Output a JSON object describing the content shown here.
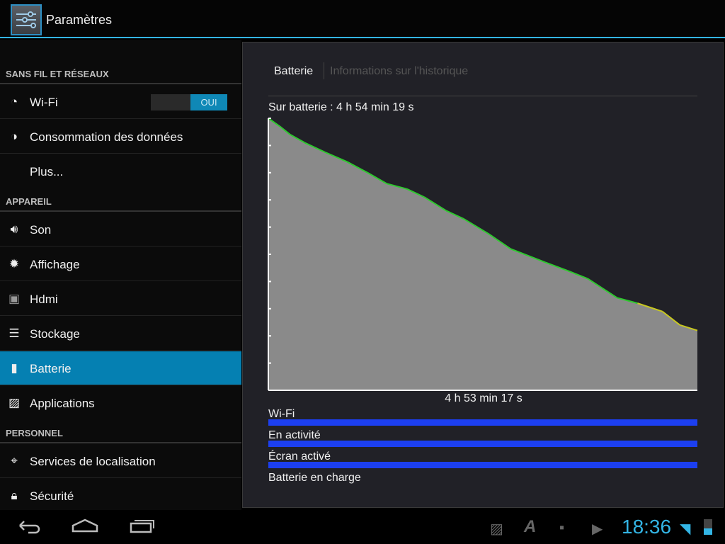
{
  "action_bar": {
    "title": "Paramètres",
    "icon": "settings-sliders-icon"
  },
  "sidebar": {
    "sections": [
      {
        "header": "SANS FIL ET RÉSEAUX"
      },
      {
        "header": "APPAREIL"
      },
      {
        "header": "PERSONNEL"
      }
    ],
    "items": [
      {
        "label": "Wi-Fi",
        "icon": "wifi-icon",
        "toggle": "OUI"
      },
      {
        "label": "Consommation des données",
        "icon": "data-usage-icon"
      },
      {
        "label": "Plus..."
      },
      {
        "label": "Son",
        "icon": "speaker-icon"
      },
      {
        "label": "Affichage",
        "icon": "brightness-icon"
      },
      {
        "label": "Hdmi",
        "icon": "hdmi-icon"
      },
      {
        "label": "Stockage",
        "icon": "storage-icon"
      },
      {
        "label": "Batterie",
        "icon": "battery-icon",
        "selected": true
      },
      {
        "label": "Applications",
        "icon": "applications-icon"
      },
      {
        "label": "Services de localisation",
        "icon": "location-icon"
      },
      {
        "label": "Sécurité",
        "icon": "lock-icon"
      }
    ]
  },
  "main": {
    "tabs": [
      {
        "label": "Batterie",
        "active": true
      },
      {
        "label": "Informations sur l'historique",
        "active": false
      }
    ],
    "on_battery": "Sur batterie : 4 h 54 min 19 s",
    "duration": "4 h 53 min 17 s",
    "tracks": [
      {
        "label": "Wi-Fi",
        "on_fraction": 1.0
      },
      {
        "label": "En activité",
        "on_fraction": 1.0
      },
      {
        "label": "Écran activé",
        "on_fraction": 1.0
      },
      {
        "label": "Batterie en charge",
        "on_fraction": 0
      }
    ],
    "colors": {
      "fill": "#8a8a8a",
      "line_good": "#2ec92e",
      "line_low": "#c8c820",
      "track": "#1c3ff0",
      "accent": "#33b5e5"
    }
  },
  "chart_data": {
    "type": "area",
    "xlabel": "",
    "ylabel": "",
    "ylim": [
      0,
      100
    ],
    "x_unit": "min",
    "y_unit": "%",
    "x": [
      0,
      8,
      15,
      25,
      39,
      54,
      68,
      81,
      95,
      107,
      122,
      134,
      151,
      166,
      190,
      205,
      219,
      239,
      253,
      270,
      282,
      294
    ],
    "y": [
      100,
      97,
      94,
      91,
      87.5,
      84,
      80,
      76,
      74,
      71,
      66,
      63,
      57.5,
      52,
      47,
      44,
      41,
      34,
      32,
      29,
      24,
      22
    ]
  },
  "status_bar": {
    "time": "18:36",
    "notification_icons": [
      "gallery-icon",
      "font-app-icon",
      "sd-card-icon",
      "play-store-icon"
    ],
    "status_icons": [
      "wifi-signal-icon",
      "battery-level-icon"
    ]
  },
  "nav": {
    "buttons": [
      "back-button",
      "home-button",
      "recent-apps-button"
    ]
  }
}
